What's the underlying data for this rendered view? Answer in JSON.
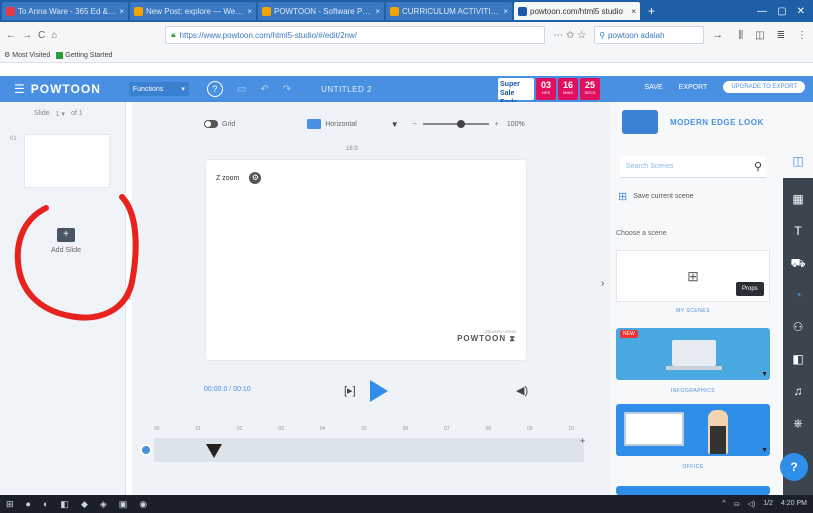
{
  "browser": {
    "tabs": [
      {
        "label": "To Anna Ware - 365 Ed & Le",
        "fav": "#e63946",
        "active": false
      },
      {
        "label": "New Post: explore — Weebl",
        "fav": "#f4a300",
        "active": false
      },
      {
        "label": "POWTOON - Software Presen",
        "fav": "#f4a300",
        "active": false
      },
      {
        "label": "CURRICULUM ACTIVITIES",
        "fav": "#f4a300",
        "active": false
      },
      {
        "label": "powtoon.com/html5 studio",
        "fav": "#1a57a8",
        "active": true
      }
    ],
    "new_tab": "+",
    "window_controls": [
      "—",
      "▢",
      "✕"
    ],
    "nav_icons": [
      "←",
      "→",
      "C",
      "⌂"
    ],
    "url": "https://www.powtoon.com/html5-studio/#/edit/2nw/",
    "url_icons": "⋯ ✩ ☆",
    "search_text": "powtoon adalah",
    "search_go": "→",
    "right_icons": [
      "⫼",
      "◫",
      "≣",
      "⋮"
    ],
    "bookmarks": [
      {
        "label": "Most Visited"
      },
      {
        "label": "Getting Started"
      }
    ]
  },
  "app": {
    "logo": "POWTOON",
    "menu_icon": "☰",
    "dropdown_label": "Functions",
    "dropdown_caret": "▾",
    "help_icon": "?",
    "title": "UNTITLED 2",
    "header_icons": [
      "▭",
      "↶",
      "↷"
    ],
    "promo": {
      "text": "Super Sale Ends Today!",
      "hours": "03",
      "minutes": "16",
      "seconds": "25",
      "hours_lbl": "HRS",
      "minutes_lbl": "MINS",
      "seconds_lbl": "SECS"
    },
    "save_label": "SAVE",
    "export_label": "EXPORT",
    "upgrade_label": "UPGRADE TO EXPORT"
  },
  "left_panel": {
    "slide_label": "Slide",
    "slide_value": "1 ▾",
    "slide_total": "of 1",
    "slide_number": "01",
    "add_slide_icon": "+",
    "add_slide_label": "Add Slide",
    "collapse_icon": "‹"
  },
  "canvas": {
    "grid_toggle_label": "Grid",
    "orientation_label": "Horizontal",
    "orientation_caret": "▼",
    "zoom_min": "−",
    "zoom_max": "+",
    "zoom_value": "100%",
    "zoom_level": 0.55,
    "dimensions": "16:9",
    "zoom_chip": "Z zoom",
    "watermark_small": "CREATED USING",
    "watermark_brand": "POWTOON",
    "watermark_icon": "⧗",
    "timecode": "00:00.0 / 00:10",
    "step_icon": "[▸]",
    "volume_icon": "◀)",
    "timeline_ticks": [
      "00",
      "01",
      "02",
      "03",
      "04",
      "05",
      "06",
      "07",
      "08",
      "09",
      "10"
    ],
    "timeline_plus": "+",
    "collapse_right_icon": "›"
  },
  "right_panel": {
    "style_name": "MODERN EDGE LOOK",
    "style_caret": "▼",
    "search_placeholder": "Search Scenes",
    "search_icon": "⚲",
    "save_scene_label": "Save current scene",
    "save_scene_icon": "⊞",
    "choose_label": "Choose a scene",
    "my_scenes_icon": "⊞",
    "categories": [
      {
        "label": "MY SCENES"
      },
      {
        "label": "INFOGRAPHICS"
      },
      {
        "label": "OFFICE"
      }
    ],
    "new_badge": "NEW",
    "more_icon": "▼"
  },
  "vtoolbar": {
    "top_icon": "◫",
    "icons": [
      "▦",
      "T",
      "⛟",
      "◔",
      "⚇",
      "◧",
      "♫",
      "⎈"
    ],
    "tooltip": "Props",
    "help_label": "?"
  },
  "taskbar": {
    "icons": [
      "⊞",
      "●",
      "◐",
      "◧",
      "◆",
      "◈",
      "▣",
      "◉"
    ],
    "tray": [
      "^",
      "⛀",
      "◁)",
      "1/2",
      "4:20 PM"
    ]
  }
}
